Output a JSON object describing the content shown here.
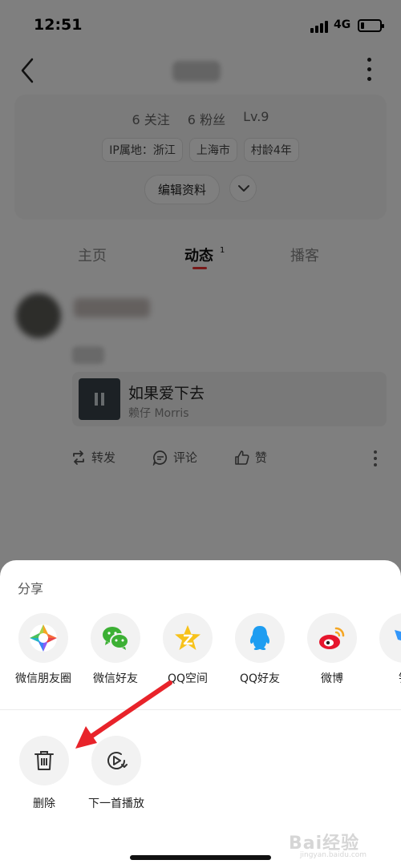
{
  "status_bar": {
    "time": "12:51",
    "network": "4G",
    "battery_level": 0.2
  },
  "profile": {
    "following": "6 关注",
    "fans": "6 粉丝",
    "level": "Lv.9",
    "tags": [
      "IP属地：浙江",
      "上海市",
      "村龄4年"
    ],
    "edit_label": "编辑资料"
  },
  "tabs": [
    {
      "label": "主页"
    },
    {
      "label": "动态",
      "badge": "1"
    },
    {
      "label": "播客"
    }
  ],
  "post": {
    "music_title": "如果爱下去",
    "music_artist": "赖仔 Morris",
    "actions": {
      "repost": "转发",
      "comment": "评论",
      "like": "赞"
    }
  },
  "share_sheet": {
    "title": "分享",
    "share_targets": [
      {
        "label": "微信朋友圈",
        "icon": "wechat-moments-icon"
      },
      {
        "label": "微信好友",
        "icon": "wechat-icon"
      },
      {
        "label": "QQ空间",
        "icon": "qzone-icon"
      },
      {
        "label": "QQ好友",
        "icon": "qq-icon"
      },
      {
        "label": "微博",
        "icon": "weibo-icon"
      },
      {
        "label": "钉",
        "icon": "dingtalk-icon"
      }
    ],
    "operations": [
      {
        "label": "删除",
        "icon": "trash-icon"
      },
      {
        "label": "下一首播放",
        "icon": "play-next-icon"
      }
    ]
  },
  "watermark": {
    "text": "Bai经验",
    "sub": "jingyan.baidu.com"
  },
  "colors": {
    "accent_red": "#e8232a",
    "tab_underline": "#ee3333"
  }
}
